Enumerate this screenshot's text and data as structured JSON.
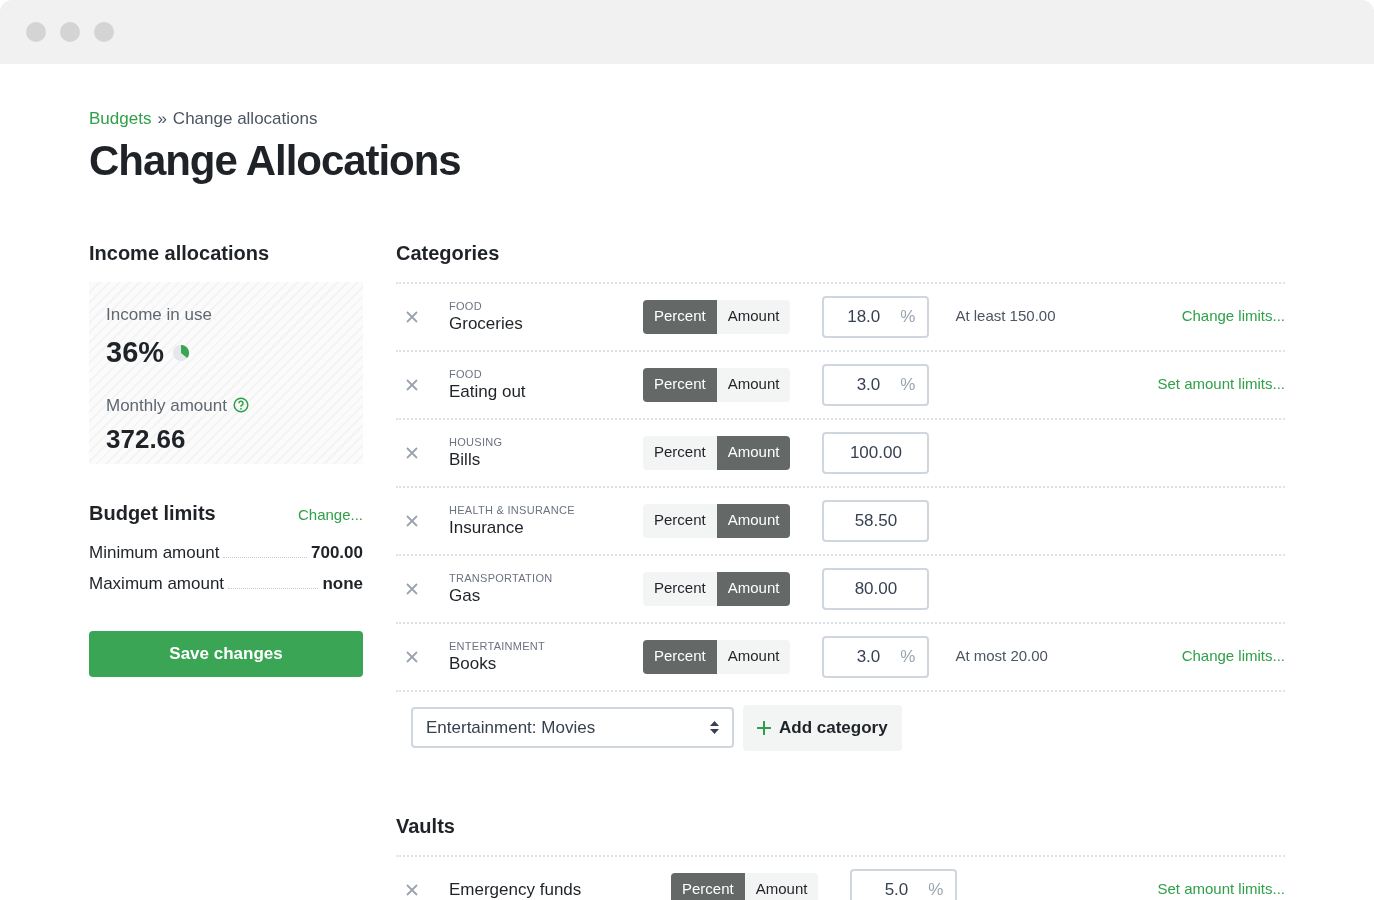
{
  "breadcrumb": {
    "link": "Budgets",
    "separator": "»",
    "current": "Change allocations"
  },
  "title": "Change Allocations",
  "income": {
    "heading": "Income allocations",
    "in_use_label": "Income in use",
    "in_use_value": "36%",
    "in_use_meter": {
      "level": 0.36
    },
    "monthly_label": "Monthly amount",
    "monthly_value": "372.66"
  },
  "limits": {
    "heading": "Budget limits",
    "change_link": "Change...",
    "rows": [
      {
        "label": "Minimum amount",
        "value": "700.00"
      },
      {
        "label": "Maximum amount",
        "value": "none"
      }
    ]
  },
  "save_button": "Save changes",
  "categories": {
    "heading": "Categories",
    "rows": [
      {
        "group": "FOOD",
        "name": "Groceries",
        "modes": [
          {
            "label": "Percent",
            "selected": true
          },
          {
            "label": "Amount",
            "selected": false
          }
        ],
        "value": "18.0",
        "unit": "%",
        "note": "At least 150.00",
        "link": "Change limits..."
      },
      {
        "group": "FOOD",
        "name": "Eating out",
        "modes": [
          {
            "label": "Percent",
            "selected": true
          },
          {
            "label": "Amount",
            "selected": false
          }
        ],
        "value": "3.0",
        "unit": "%",
        "link": "Set amount limits..."
      },
      {
        "group": "HOUSING",
        "name": "Bills",
        "modes": [
          {
            "label": "Percent",
            "selected": false
          },
          {
            "label": "Amount",
            "selected": true
          }
        ],
        "value": "100.00"
      },
      {
        "group": "HEALTH & INSURANCE",
        "name": "Insurance",
        "modes": [
          {
            "label": "Percent",
            "selected": false
          },
          {
            "label": "Amount",
            "selected": true
          }
        ],
        "value": "58.50"
      },
      {
        "group": "TRANSPORTATION",
        "name": "Gas",
        "modes": [
          {
            "label": "Percent",
            "selected": false
          },
          {
            "label": "Amount",
            "selected": true
          }
        ],
        "value": "80.00"
      },
      {
        "group": "ENTERTAINMENT",
        "name": "Books",
        "modes": [
          {
            "label": "Percent",
            "selected": true
          },
          {
            "label": "Amount",
            "selected": false
          }
        ],
        "value": "3.0",
        "unit": "%",
        "note": "At most 20.00",
        "link": "Change limits..."
      }
    ],
    "select_value": "Entertainment: Movies",
    "add_button": "Add category"
  },
  "vaults": {
    "heading": "Vaults",
    "rows": [
      {
        "name": "Emergency funds",
        "modes": [
          {
            "label": "Percent",
            "selected": true
          },
          {
            "label": "Amount",
            "selected": false
          }
        ],
        "value": "5.0",
        "unit": "%",
        "link": "Set amount limits..."
      }
    ]
  }
}
